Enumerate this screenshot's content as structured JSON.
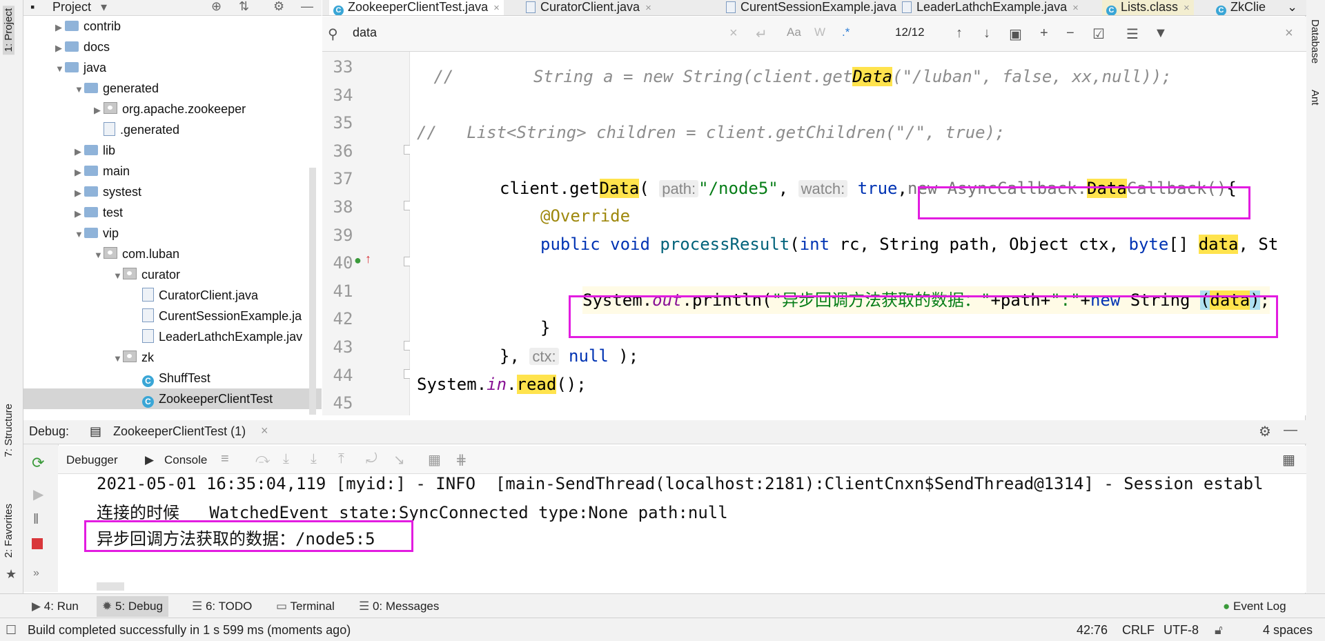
{
  "left_strip": {
    "project_label": "1: Project",
    "structure_label": "7: Structure",
    "favorites_label": "2: Favorites"
  },
  "right_strip": {
    "database_label": "Database",
    "ant_label": "Ant"
  },
  "project": {
    "title": "Project",
    "tree": [
      {
        "label": "contrib",
        "type": "folder",
        "depth": 2,
        "expand": "▶"
      },
      {
        "label": "docs",
        "type": "folder",
        "depth": 2,
        "expand": "▶"
      },
      {
        "label": "java",
        "type": "folder",
        "depth": 2,
        "expand": "▼"
      },
      {
        "label": "generated",
        "type": "folder",
        "depth": 3,
        "expand": "▼"
      },
      {
        "label": "org.apache.zookeeper",
        "type": "package",
        "depth": 4,
        "expand": "▶"
      },
      {
        "label": ".generated",
        "type": "file",
        "depth": 4,
        "expand": ""
      },
      {
        "label": "lib",
        "type": "folder",
        "depth": 3,
        "expand": "▶"
      },
      {
        "label": "main",
        "type": "folder",
        "depth": 3,
        "expand": "▶"
      },
      {
        "label": "systest",
        "type": "folder",
        "depth": 3,
        "expand": "▶"
      },
      {
        "label": "test",
        "type": "folder",
        "depth": 3,
        "expand": "▶"
      },
      {
        "label": "vip",
        "type": "folder",
        "depth": 3,
        "expand": "▼"
      },
      {
        "label": "com.luban",
        "type": "package",
        "depth": 4,
        "expand": "▼"
      },
      {
        "label": "curator",
        "type": "package",
        "depth": 5,
        "expand": "▼"
      },
      {
        "label": "CuratorClient.java",
        "type": "java",
        "depth": 6,
        "expand": ""
      },
      {
        "label": "CurentSessionExample.ja",
        "type": "java",
        "depth": 6,
        "expand": ""
      },
      {
        "label": "LeaderLathchExample.jav",
        "type": "java",
        "depth": 6,
        "expand": ""
      },
      {
        "label": "zk",
        "type": "package",
        "depth": 5,
        "expand": "▼"
      },
      {
        "label": "ShuffTest",
        "type": "class",
        "depth": 6,
        "expand": ""
      },
      {
        "label": "ZookeeperClientTest",
        "type": "class",
        "depth": 6,
        "expand": "",
        "selected": true
      }
    ]
  },
  "tabs": [
    {
      "label": "ZookeeperClientTest.java",
      "active": true
    },
    {
      "label": "CuratorClient.java"
    },
    {
      "label": "CurentSessionExample.java"
    },
    {
      "label": "LeaderLathchExample.java"
    },
    {
      "label": "Lists.class"
    },
    {
      "label": "ZkClie"
    }
  ],
  "search": {
    "query": "data",
    "match_count": "12/12",
    "case_label": "Aa",
    "word_label": "W",
    "regex_label": ".*"
  },
  "editor": {
    "line_numbers": [
      "33",
      "34",
      "35",
      "36",
      "37",
      "38",
      "39",
      "40",
      "41",
      "42",
      "43",
      "44",
      "45"
    ],
    "line34": {
      "prefix": " //        String a = new String(client.get",
      "hl": "Data",
      "suffix": "(\"/luban\", false, xx,null));"
    },
    "line36": "//   List<String> children = client.getChildren(\"/\", true);",
    "line38": {
      "a": "client.get",
      "b": "Data",
      "c": "(",
      "hint_path": "path:",
      "str": "\"/node5\"",
      "d": ",",
      "hint_watch": "watch:",
      "kw_true": "true",
      "e": ",",
      "f": "new AsyncCallback.",
      "g": "Data",
      "h": "Callback()",
      "i": "{"
    },
    "line39": "@Override",
    "line40": {
      "kw1": "public void ",
      "fn": "processResult",
      "p1": "(",
      "kw2": "int",
      "p2": " rc, String path, Object ctx, ",
      "kw3": "byte",
      "p3": "[] ",
      "hl": "data",
      "p4": ", St"
    },
    "line42": {
      "a": "System.",
      "b": "out",
      "c": ".println(",
      "str": "\"异步回调方法获取的数据：\"",
      "d": "+path+",
      "str2": "\":\"",
      "e": "+",
      "kw": "new",
      "f": " String ",
      "g": "(",
      "hl": "data",
      "h": ")",
      ";": ";"
    },
    "line43": "}",
    "line44": {
      "a": "}, ",
      "hint": "ctx:",
      "kw": " null",
      "b": " );"
    },
    "line45": {
      "a": "System.",
      "b": "in",
      "c": ".",
      "d": "read",
      "e": "();"
    }
  },
  "debug": {
    "label": "Debug:",
    "session": "ZookeeperClientTest (1)",
    "debugger_tab": "Debugger",
    "console_tab": "Console"
  },
  "console": {
    "lines": [
      "2021-05-01 16:35:04,119 [myid:] - INFO  [main-SendThread(localhost:2181):ClientCnxn$SendThread@1314] - Session establ",
      "连接的时候   WatchedEvent state:SyncConnected type:None path:null",
      "异步回调方法获取的数据：/node5:5"
    ]
  },
  "bottom_tabs": [
    {
      "label": "4: Run"
    },
    {
      "label": "5: Debug",
      "active": true
    },
    {
      "label": "6: TODO"
    },
    {
      "label": "Terminal"
    },
    {
      "label": "0: Messages"
    }
  ],
  "event_log": "Event Log",
  "status": {
    "message": "Build completed successfully in 1 s 599 ms (moments ago)",
    "position": "42:76",
    "line_sep": "CRLF",
    "encoding": "UTF-8",
    "indent": "4 spaces"
  },
  "colors": {
    "highlight": "#ffe34d",
    "annotation_box": "#e21ce0",
    "keyword": "#0033b3",
    "string": "#067d17"
  }
}
